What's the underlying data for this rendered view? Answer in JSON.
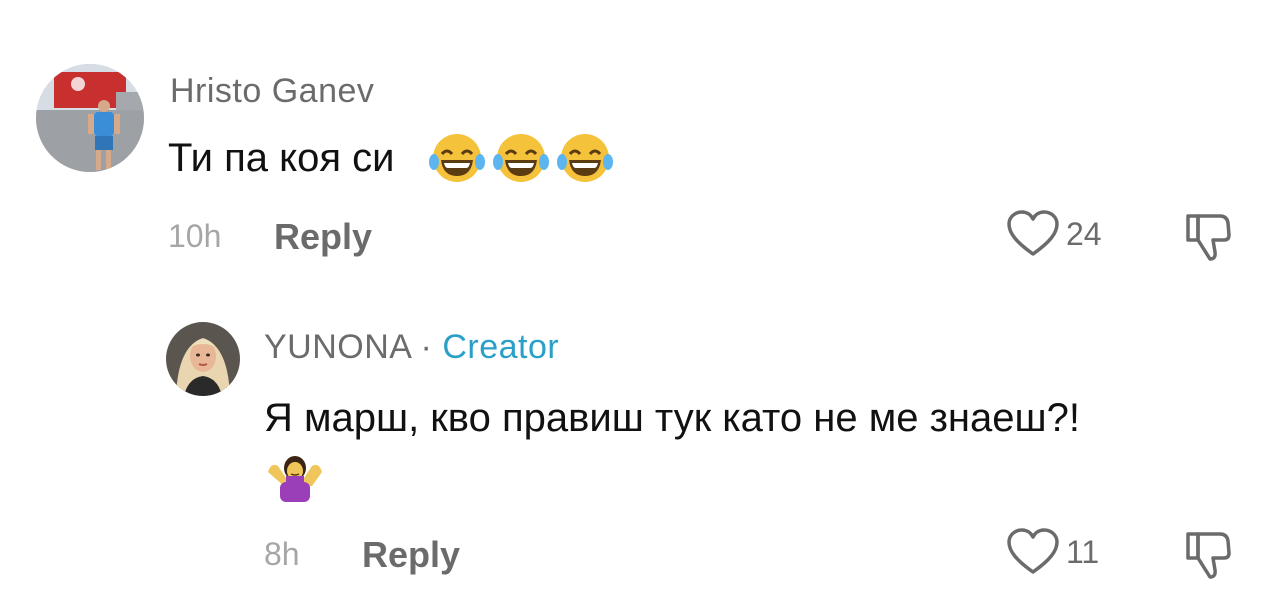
{
  "comments": [
    {
      "username": "Hristo Ganev",
      "text": "Ти па коя си",
      "emojis": [
        "face-with-tears-of-joy-icon",
        "face-with-tears-of-joy-icon",
        "face-with-tears-of-joy-icon"
      ],
      "time": "10h",
      "reply_label": "Reply",
      "likes": "24"
    },
    {
      "username": "YUNONA",
      "separator": "·",
      "badge": "Creator",
      "text": "Я марш, кво правиш тук като не ме знаеш?!",
      "emojis": [
        "person-shrugging-icon"
      ],
      "time": "8h",
      "reply_label": "Reply",
      "likes": "11"
    }
  ],
  "colors": {
    "creator_badge": "#2aa0c8",
    "secondary_text": "#6b6b6b",
    "timestamp": "#a6a6a6",
    "primary_text": "#111111"
  }
}
